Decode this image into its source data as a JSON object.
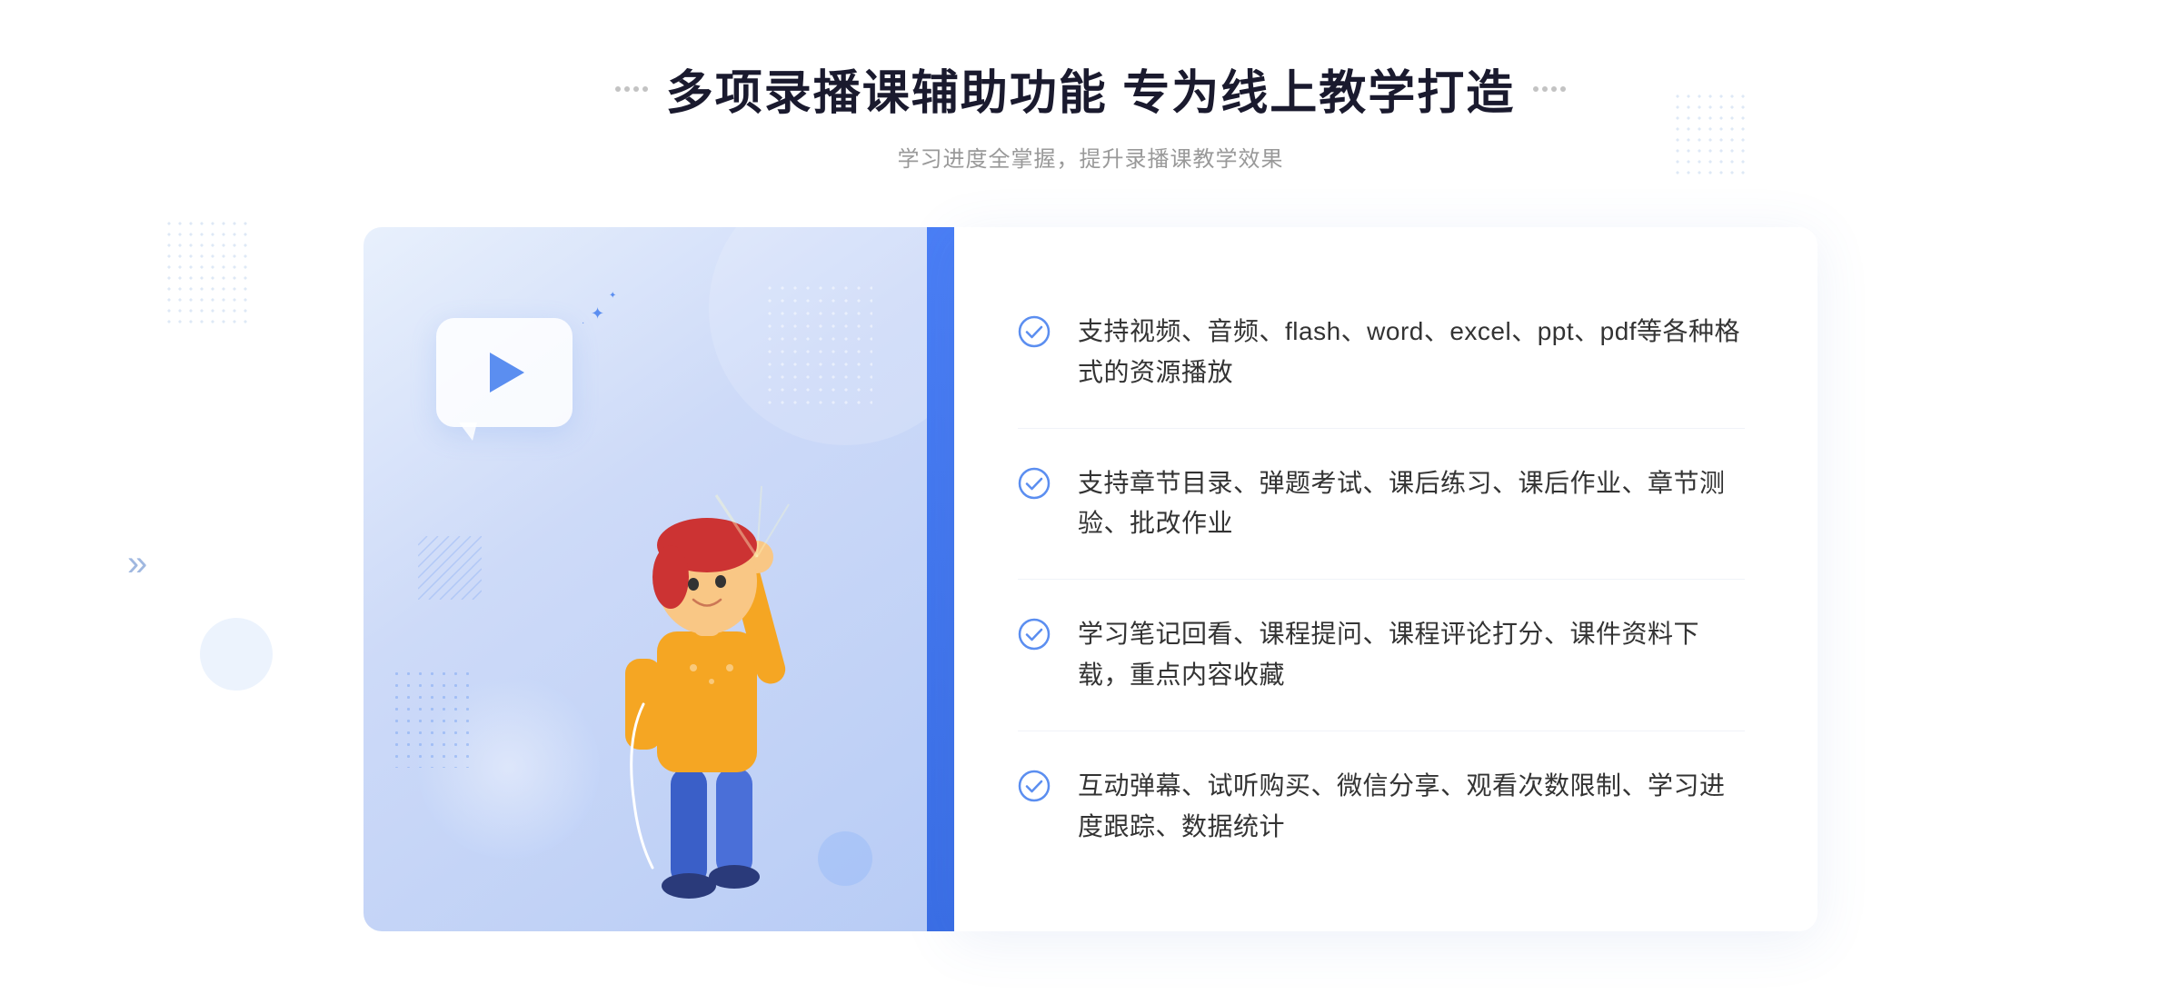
{
  "header": {
    "title": "多项录播课辅助功能 专为线上教学打造",
    "subtitle": "学习进度全掌握，提升录播课教学效果",
    "left_dots": "decoration",
    "right_dots": "decoration"
  },
  "features": [
    {
      "id": "feature-1",
      "text": "支持视频、音频、flash、word、excel、ppt、pdf等各种格式的资源播放",
      "check": "check-circle-icon"
    },
    {
      "id": "feature-2",
      "text": "支持章节目录、弹题考试、课后练习、课后作业、章节测验、批改作业",
      "check": "check-circle-icon"
    },
    {
      "id": "feature-3",
      "text": "学习笔记回看、课程提问、课程评论打分、课件资料下载，重点内容收藏",
      "check": "check-circle-icon"
    },
    {
      "id": "feature-4",
      "text": "互动弹幕、试听购买、微信分享、观看次数限制、学习进度跟踪、数据统计",
      "check": "check-circle-icon"
    }
  ],
  "illustration": {
    "alt": "录播课功能插图"
  }
}
